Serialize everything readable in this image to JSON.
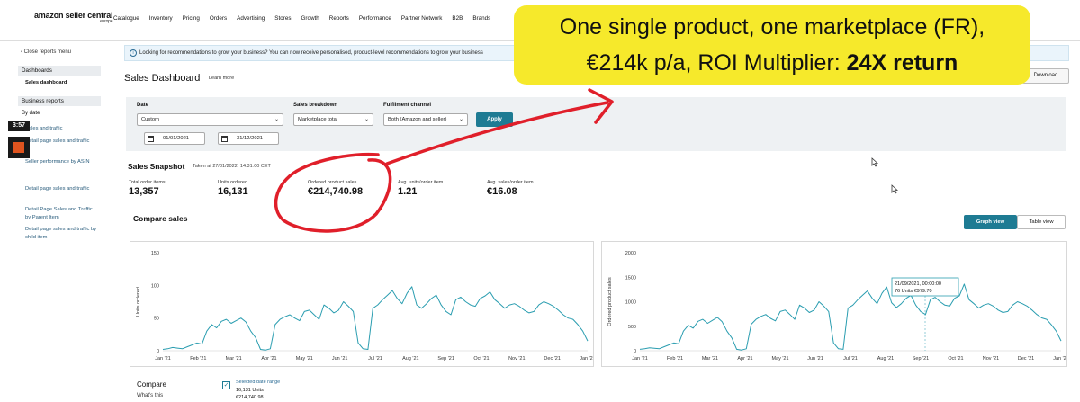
{
  "brand": {
    "name": "amazon seller central",
    "region": "europe"
  },
  "nav": [
    "Catalogue",
    "Inventory",
    "Pricing",
    "Orders",
    "Advertising",
    "Stores",
    "Growth",
    "Reports",
    "Performance",
    "Partner Network",
    "B2B",
    "Brands"
  ],
  "sidebar": {
    "close": "‹ Close reports menu",
    "dashboards_head": "Dashboards",
    "sales_dashboard": "Sales dashboard",
    "business_head": "Business reports",
    "by_date": "By date",
    "items": [
      "Sales and traffic",
      "Detail page sales and traffic",
      "Seller performance by ASIN",
      "Detail page sales and traffic",
      "Detail Page Sales and Traffic by Parent Item",
      "Detail page sales and traffic by child item"
    ],
    "timer": "3:57"
  },
  "banner": "Looking for recommendations to grow your business? You can now receive personalised, product-level recommendations to grow your business",
  "page": {
    "title": "Sales Dashboard",
    "learn_more": "Learn more",
    "download": "Download"
  },
  "filters": {
    "date_label": "Date",
    "date_value": "Custom",
    "breakdown_label": "Sales breakdown",
    "breakdown_value": "Marketplace total",
    "fulfilment_label": "Fulfilment channel",
    "fulfilment_value": "Both (Amazon and seller)",
    "apply": "Apply",
    "start_date": "01/01/2021",
    "end_date": "31/12/2021"
  },
  "snapshot": {
    "title": "Sales Snapshot",
    "taken": "Taken at 27/01/2022, 14:31:00 CET",
    "metrics": [
      {
        "label": "Total order items",
        "value": "13,357"
      },
      {
        "label": "Units ordered",
        "value": "16,131"
      },
      {
        "label": "Ordered product sales",
        "value": "€214,740.98"
      },
      {
        "label": "Avg. units/order item",
        "value": "1.21"
      },
      {
        "label": "Avg. sales/order item",
        "value": "€16.08"
      }
    ]
  },
  "compare": {
    "title": "Compare sales",
    "graph_view": "Graph view",
    "table_view": "Table view",
    "footer_label": "Compare",
    "whats_this": "What's this",
    "selected_range": "Selected date range",
    "units": "16,131 Units",
    "sales": "€214,740.98"
  },
  "chart_data": [
    {
      "type": "line",
      "title": "",
      "xlabel": "",
      "ylabel": "Units ordered",
      "ylim": [
        0,
        150
      ],
      "yticks": [
        "0",
        "50",
        "100",
        "150"
      ],
      "x_ticks": [
        "Jan '21",
        "Feb '21",
        "Mar '21",
        "Apr '21",
        "May '21",
        "Jun '21",
        "Jul '21",
        "Aug '21",
        "Sep '21",
        "Oct '21",
        "Nov '21",
        "Dec '21",
        "Jan '22"
      ],
      "color": "#2a9db0",
      "series": [
        {
          "values": [
            2,
            3,
            5,
            4,
            3,
            6,
            9,
            12,
            10,
            30,
            40,
            35,
            45,
            48,
            42,
            46,
            50,
            44,
            30,
            20,
            2,
            1,
            3,
            40,
            48,
            52,
            55,
            50,
            46,
            60,
            62,
            55,
            48,
            70,
            65,
            58,
            62,
            75,
            68,
            60,
            12,
            3,
            2,
            65,
            70,
            78,
            85,
            92,
            80,
            72,
            88,
            98,
            70,
            65,
            72,
            80,
            85,
            70,
            60,
            55,
            78,
            82,
            75,
            70,
            68,
            80,
            84,
            90,
            78,
            72,
            65,
            70,
            72,
            68,
            62,
            58,
            60,
            70,
            75,
            72,
            68,
            62,
            55,
            50,
            48,
            40,
            30,
            15
          ]
        }
      ]
    },
    {
      "type": "line",
      "title": "",
      "xlabel": "",
      "ylabel": "Ordered product sales",
      "ylim": [
        0,
        2000
      ],
      "yticks": [
        "0",
        "500",
        "1000",
        "1500",
        "2000"
      ],
      "x_ticks": [
        "Jan '21",
        "Feb '21",
        "Mar '21",
        "Apr '21",
        "May '21",
        "Jun '21",
        "Jul '21",
        "Aug '21",
        "Sep '21",
        "Oct '21",
        "Nov '21",
        "Dec '21",
        "Jan '22"
      ],
      "color": "#2a9db0",
      "tooltip": {
        "date": "21/09/2021, 00:00:00",
        "units": "76 Units",
        "sales": "€979.70"
      },
      "series": [
        {
          "values": [
            30,
            40,
            60,
            50,
            40,
            80,
            120,
            160,
            140,
            400,
            520,
            460,
            600,
            640,
            560,
            620,
            680,
            590,
            400,
            260,
            30,
            15,
            40,
            540,
            640,
            700,
            740,
            660,
            610,
            800,
            830,
            740,
            640,
            930,
            870,
            780,
            830,
            1000,
            910,
            800,
            160,
            40,
            30,
            870,
            930,
            1040,
            1130,
            1220,
            1070,
            960,
            1170,
            1300,
            980,
            880,
            960,
            1070,
            1130,
            930,
            800,
            740,
            1040,
            1090,
            1000,
            930,
            910,
            1070,
            1120,
            1360,
            1040,
            960,
            870,
            930,
            960,
            910,
            830,
            780,
            800,
            930,
            1000,
            960,
            910,
            830,
            740,
            670,
            640,
            530,
            400,
            200
          ]
        }
      ]
    }
  ],
  "overlay": {
    "callout_line1": "One single product, one marketplace (FR),",
    "callout_line2a": "€214k p/a, ROI Multiplier: ",
    "callout_line2b": "24X return"
  }
}
